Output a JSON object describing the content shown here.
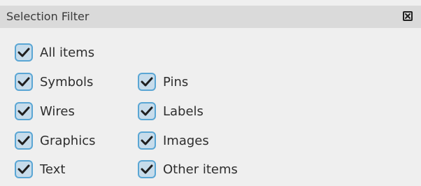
{
  "panel": {
    "title": "Selection Filter",
    "close_icon": "close-box-icon"
  },
  "items": {
    "all_items": {
      "label": "All items",
      "checked": true
    },
    "symbols": {
      "label": "Symbols",
      "checked": true
    },
    "pins": {
      "label": "Pins",
      "checked": true
    },
    "wires": {
      "label": "Wires",
      "checked": true
    },
    "labels": {
      "label": "Labels",
      "checked": true
    },
    "graphics": {
      "label": "Graphics",
      "checked": true
    },
    "images": {
      "label": "Images",
      "checked": true
    },
    "text": {
      "label": "Text",
      "checked": true
    },
    "other_items": {
      "label": "Other items",
      "checked": true
    }
  },
  "colors": {
    "checkbox_border": "#5aa6d4",
    "checkbox_fill": "#c7dceb",
    "checkmark": "#1f1f1f",
    "titlebar": "#dadada",
    "background": "#efefef"
  }
}
